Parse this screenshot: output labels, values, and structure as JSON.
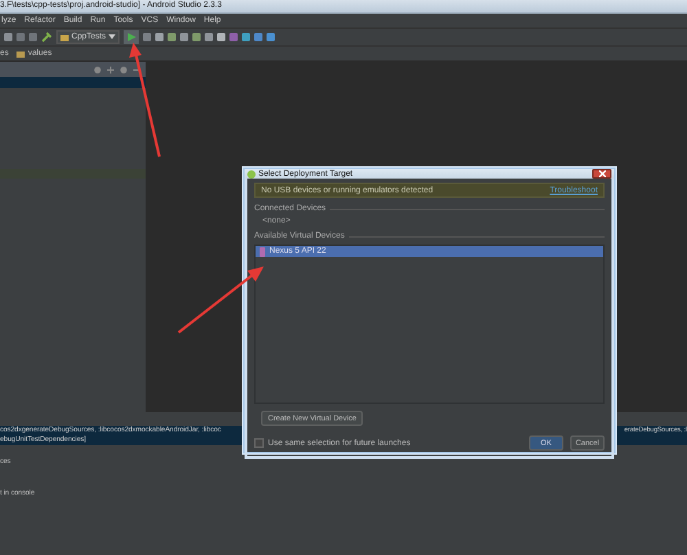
{
  "window": {
    "title": "3.F\\tests\\cpp-tests\\proj.android-studio] - Android Studio 2.3.3"
  },
  "menu": [
    "lyze",
    "Refactor",
    "Build",
    "Run",
    "Tools",
    "VCS",
    "Window",
    "Help"
  ],
  "toolbar": {
    "run_config": "CppTests"
  },
  "breadcrumb": [
    "es",
    "values"
  ],
  "console": [
    {
      "text": "cos2dxgenerateDebugSources, :libcocos2dxmockableAndroidJar, :libcoc",
      "right": "erateDebugSources, :l",
      "selected": true
    },
    {
      "text": "ebugUnitTestDependencies]",
      "selected": true
    },
    {
      "text": "ces",
      "selected": false
    },
    {
      "text": "t in console",
      "selected": false
    }
  ],
  "dialog": {
    "title": "Select Deployment Target",
    "message": "No USB devices or running emulators detected",
    "link": "Troubleshoot",
    "connected": {
      "heading": "Connected Devices",
      "empty": "<none>"
    },
    "virtual": {
      "heading": "Available Virtual Devices",
      "devices": [
        {
          "name": "Nexus 5 API 22",
          "selected": true
        }
      ]
    },
    "create_button": "Create New Virtual Device",
    "checkbox": {
      "label": "Use same selection for future launches",
      "checked": false
    },
    "buttons": [
      {
        "label": "OK",
        "default": true
      },
      {
        "label": "Cancel",
        "default": false
      }
    ]
  }
}
